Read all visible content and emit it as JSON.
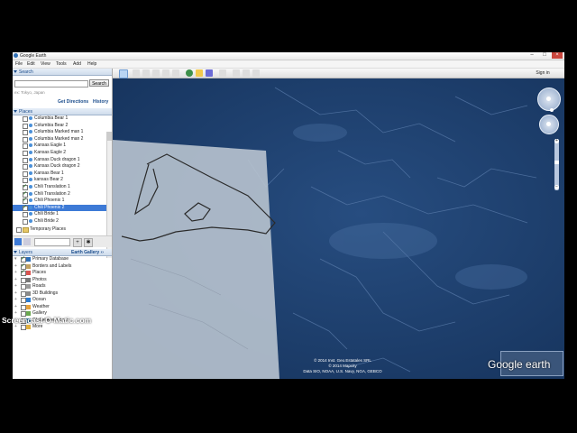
{
  "window": {
    "title": "Google Earth"
  },
  "menu": [
    "File",
    "Edit",
    "View",
    "Tools",
    "Add",
    "Help"
  ],
  "search": {
    "header": "Search",
    "placeholder": "",
    "button": "Search",
    "hint": "ex: Tokyo, Japan",
    "get_directions": "Get Directions",
    "history": "History"
  },
  "places": {
    "header": "Places",
    "items": [
      {
        "label": "Columbia Bear 1",
        "checked": false,
        "selected": false
      },
      {
        "label": "Columbia Bear 2",
        "checked": false,
        "selected": false
      },
      {
        "label": "Columbia Marked man 1",
        "checked": false,
        "selected": false
      },
      {
        "label": "Columbia Marked man 2",
        "checked": false,
        "selected": false
      },
      {
        "label": "Kansas Eagle 1",
        "checked": false,
        "selected": false
      },
      {
        "label": "Kansas Eagle 2",
        "checked": false,
        "selected": false
      },
      {
        "label": "Kansas Duck dragon 1",
        "checked": false,
        "selected": false
      },
      {
        "label": "Kansas Duck dragon 2",
        "checked": false,
        "selected": false
      },
      {
        "label": "Kansas Bear 1",
        "checked": false,
        "selected": false
      },
      {
        "label": "kansas Bear 2",
        "checked": false,
        "selected": false
      },
      {
        "label": "Chili Translation 1",
        "checked": true,
        "selected": false
      },
      {
        "label": "Chili Translation 2",
        "checked": true,
        "selected": false
      },
      {
        "label": "Chili Phoenix 1",
        "checked": true,
        "selected": false
      },
      {
        "label": "Chili Phoenix 2",
        "checked": true,
        "selected": true
      },
      {
        "label": "Chili Bride 1",
        "checked": false,
        "selected": false
      },
      {
        "label": "Chili Bride 2",
        "checked": false,
        "selected": false
      }
    ],
    "temporary": "Temporary Places"
  },
  "layers": {
    "header": "Layers",
    "gallery": "Earth Gallery",
    "items": [
      {
        "label": "Primary Database",
        "color": "#2f6fb5"
      },
      {
        "label": "Borders and Labels",
        "color": "#c0a060"
      },
      {
        "label": "Places",
        "color": "#d9534f"
      },
      {
        "label": "Photos",
        "color": "#777777"
      },
      {
        "label": "Roads",
        "color": "#999999"
      },
      {
        "label": "3D Buildings",
        "color": "#8a8a8a"
      },
      {
        "label": "Ocean",
        "color": "#2a7bd1"
      },
      {
        "label": "Weather",
        "color": "#e6a23c"
      },
      {
        "label": "Gallery",
        "color": "#6aa84f"
      },
      {
        "label": "Global Awareness",
        "color": "#3c8dbc"
      },
      {
        "label": "More",
        "color": "#e0b040"
      }
    ]
  },
  "toolbar": {
    "signin": "Sign in"
  },
  "map": {
    "attribution": [
      "© 2014 Inst. Geo.Estatales SRL",
      "© 2014 Mapcity",
      "Data SIO, NOAA, U.S. Navy, NGA, GEBCO"
    ],
    "logo": "Google earth"
  },
  "watermark": "Screencast-O-Matic.com"
}
